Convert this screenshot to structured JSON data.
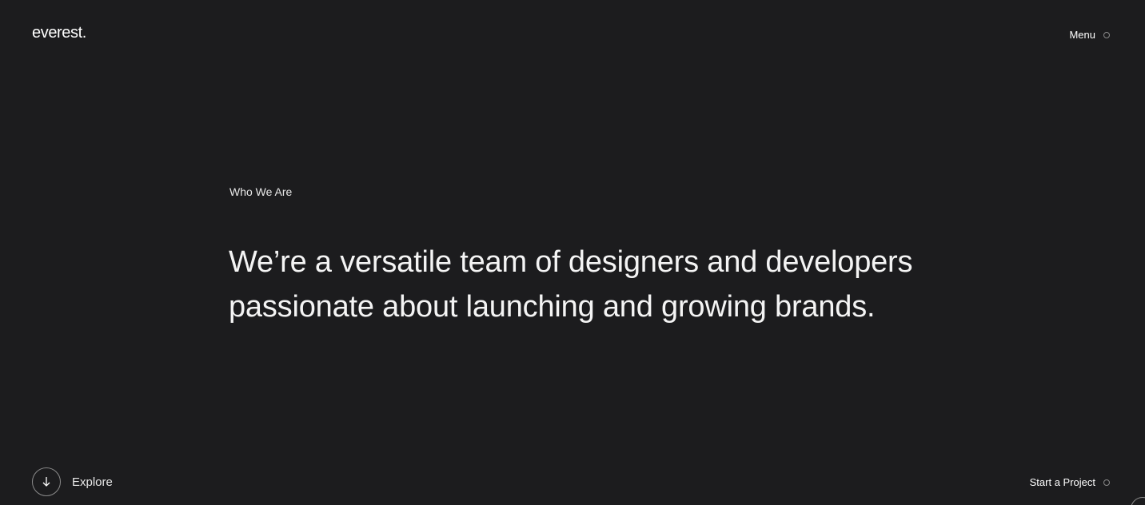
{
  "header": {
    "logo": "everest.",
    "menu_label": "Menu",
    "menu_icon": "circle-icon"
  },
  "hero": {
    "eyebrow": "Who We Are",
    "headline_line1": "We’re a versatile team of designers and developers",
    "headline_line2": "passionate about launching and growing brands."
  },
  "footer": {
    "explore_label": "Explore",
    "explore_icon": "arrow-down-icon",
    "start_label": "Start a Project",
    "start_icon": "circle-icon"
  },
  "colors": {
    "background": "#1c1c1e",
    "text": "#f2f2f2",
    "outline": "#8a8a8a"
  }
}
